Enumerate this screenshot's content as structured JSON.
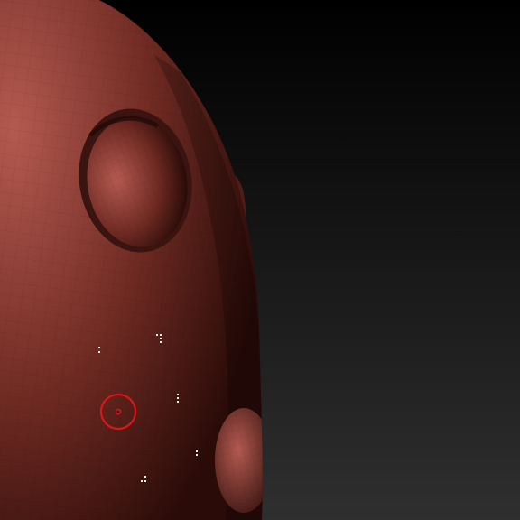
{
  "scene": {
    "background": {
      "top_color": "#000000",
      "bottom_color": "#2f2f2f"
    },
    "model": {
      "name": "sculpted-head-mesh",
      "base_color": "#6e2a22",
      "highlight_color": "#b45a50",
      "shadow_color": "#2a0b08",
      "wireframe_visible": true
    },
    "brush_cursor": {
      "icon": "brush-ring-icon",
      "color": "#d81818"
    },
    "markers": [
      {
        "icon": "vertex-marker-icon"
      },
      {
        "icon": "vertex-marker-icon"
      },
      {
        "icon": "vertex-marker-icon"
      },
      {
        "icon": "vertex-marker-icon"
      },
      {
        "icon": "vertex-marker-icon"
      }
    ]
  }
}
